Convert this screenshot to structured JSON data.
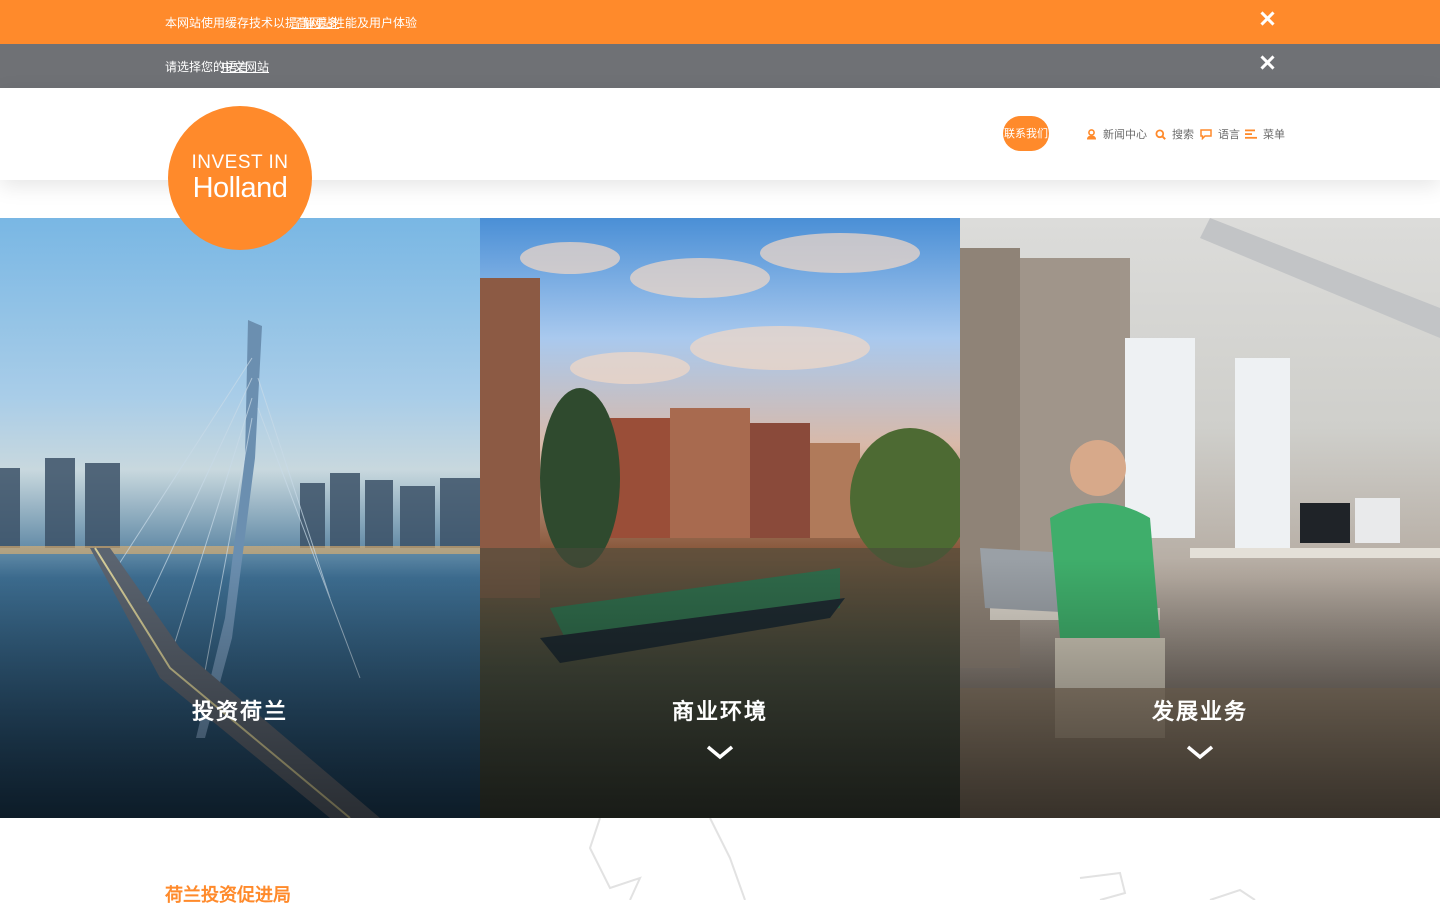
{
  "notices": [
    {
      "message": "本网站使用缓存技术以提高网站性能及用户体验",
      "link": "了解更多"
    },
    {
      "message": "请选择您的语言",
      "link": "中文网站"
    }
  ],
  "logo": {
    "line1": "INVEST IN",
    "line2": "Holland"
  },
  "nav": {
    "primary": "联系我们",
    "items": [
      {
        "label": "新闻中心",
        "icon": "person-icon"
      },
      {
        "label": "搜索",
        "icon": "search-icon"
      },
      {
        "label": "语言",
        "icon": "chat-icon"
      },
      {
        "label": "菜单",
        "icon": "menu-icon"
      }
    ]
  },
  "panels": [
    {
      "label": "投资荷兰",
      "image": "Erasmus bridge and Rotterdam skyline at dusk"
    },
    {
      "label": "商业环境",
      "image": "Amsterdam canal with historic houses and houseboat"
    },
    {
      "label": "发展业务",
      "image": "Office workers at desks with laptops"
    }
  ],
  "section": {
    "title": "荷兰投资促进局"
  },
  "colors": {
    "accent": "#ff8a2b",
    "notice_grey": "#6f7175"
  }
}
